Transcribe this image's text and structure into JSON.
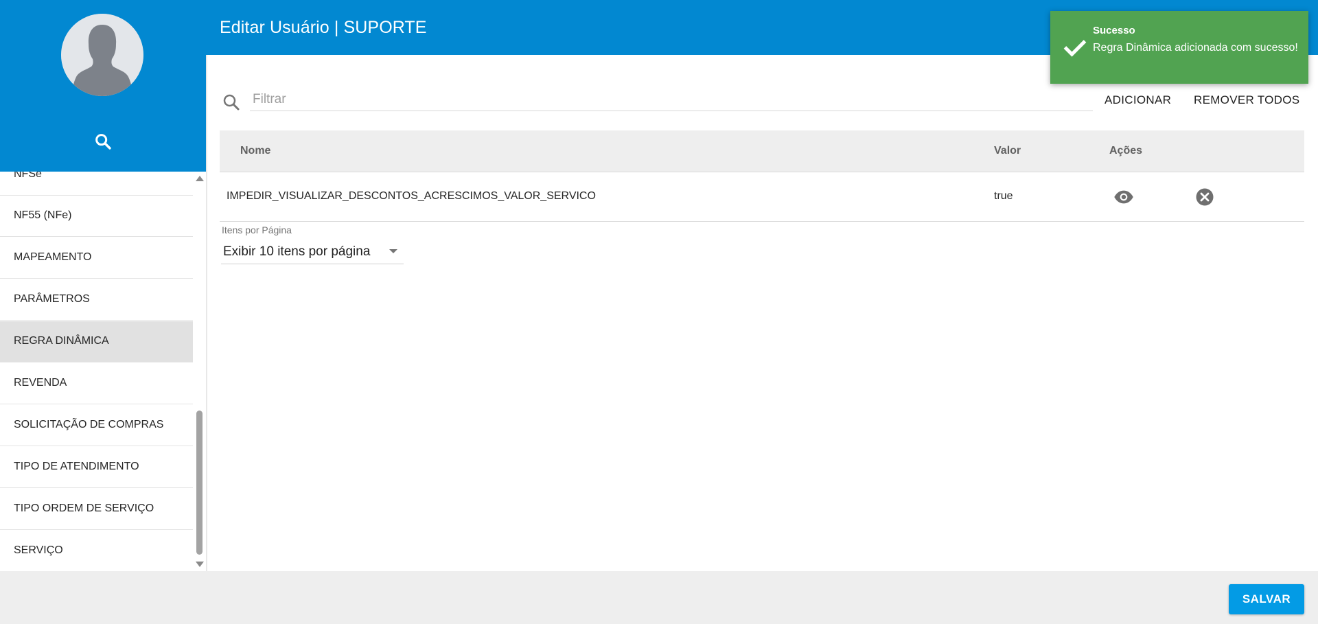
{
  "header": {
    "title": "Editar Usuário | SUPORTE"
  },
  "sidebar": {
    "items": [
      {
        "label": "NFSe"
      },
      {
        "label": "NF55 (NFe)"
      },
      {
        "label": "MAPEAMENTO"
      },
      {
        "label": "PARÂMETROS"
      },
      {
        "label": "REGRA DINÂMICA",
        "active": true
      },
      {
        "label": "REVENDA"
      },
      {
        "label": "SOLICITAÇÃO DE COMPRAS"
      },
      {
        "label": "TIPO DE ATENDIMENTO"
      },
      {
        "label": "TIPO ORDEM DE SERVIÇO"
      },
      {
        "label": "SERVIÇO"
      }
    ]
  },
  "filter": {
    "placeholder": "Filtrar"
  },
  "actions": {
    "add_label": "ADICIONAR",
    "remove_all_label": "REMOVER TODOS"
  },
  "table": {
    "headers": {
      "name": "Nome",
      "value": "Valor",
      "actions": "Ações"
    },
    "rows": [
      {
        "name": "IMPEDIR_VISUALIZAR_DESCONTOS_ACRESCIMOS_VALOR_SERVICO",
        "value": "true"
      }
    ]
  },
  "pagination": {
    "label": "Itens por Página",
    "selected": "Exibir 10 itens por página"
  },
  "footer": {
    "save_label": "SALVAR"
  },
  "toast": {
    "title": "Sucesso",
    "message": "Regra Dinâmica adicionada com sucesso!"
  },
  "colors": {
    "primary": "#0288d1",
    "save_button": "#039be5",
    "toast_success": "#51a351",
    "active_item": "#e1e1e1"
  },
  "icons": {
    "sidebar_search": "search-icon",
    "filter": "search-icon",
    "view": "eye-icon",
    "delete": "close-circle-icon",
    "toast": "checkmark-icon"
  }
}
